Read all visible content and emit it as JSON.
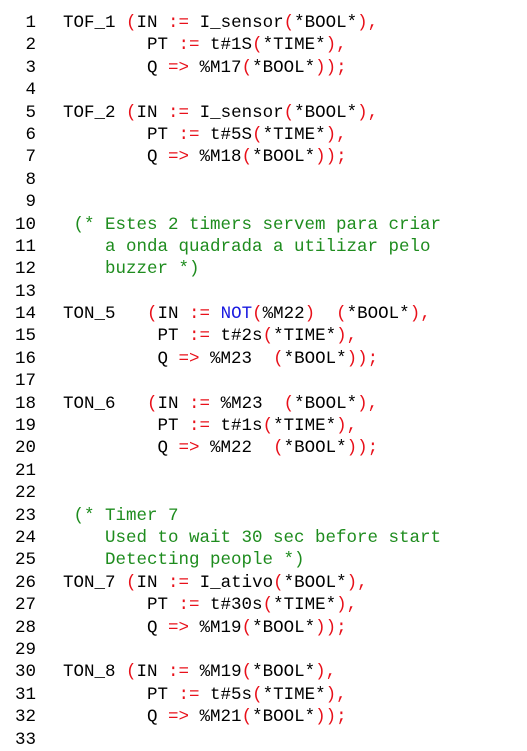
{
  "colors": {
    "background": "#ffffff",
    "default": "#000000",
    "operator": "#e8101a",
    "comment": "#1e8c1e",
    "keyword": "#1a1ae0"
  },
  "lines": [
    {
      "n": "1",
      "tokens": [
        {
          "t": "TOF_1 ",
          "c": "blk"
        },
        {
          "t": "(",
          "c": "red"
        },
        {
          "t": "IN ",
          "c": "blk"
        },
        {
          "t": ":=",
          "c": "red"
        },
        {
          "t": " I_sensor",
          "c": "blk"
        },
        {
          "t": "(",
          "c": "red"
        },
        {
          "t": "*BOOL*",
          "c": "blk"
        },
        {
          "t": "),",
          "c": "red"
        }
      ]
    },
    {
      "n": "2",
      "tokens": [
        {
          "t": "        PT ",
          "c": "blk"
        },
        {
          "t": ":=",
          "c": "red"
        },
        {
          "t": " t#1S",
          "c": "blk"
        },
        {
          "t": "(",
          "c": "red"
        },
        {
          "t": "*TIME*",
          "c": "blk"
        },
        {
          "t": "),",
          "c": "red"
        }
      ]
    },
    {
      "n": "3",
      "tokens": [
        {
          "t": "        Q ",
          "c": "blk"
        },
        {
          "t": "=>",
          "c": "red"
        },
        {
          "t": " %M17",
          "c": "blk"
        },
        {
          "t": "(",
          "c": "red"
        },
        {
          "t": "*BOOL*",
          "c": "blk"
        },
        {
          "t": "));",
          "c": "red"
        }
      ]
    },
    {
      "n": "4",
      "tokens": []
    },
    {
      "n": "5",
      "tokens": [
        {
          "t": "TOF_2 ",
          "c": "blk"
        },
        {
          "t": "(",
          "c": "red"
        },
        {
          "t": "IN ",
          "c": "blk"
        },
        {
          "t": ":=",
          "c": "red"
        },
        {
          "t": " I_sensor",
          "c": "blk"
        },
        {
          "t": "(",
          "c": "red"
        },
        {
          "t": "*BOOL*",
          "c": "blk"
        },
        {
          "t": "),",
          "c": "red"
        }
      ]
    },
    {
      "n": "6",
      "tokens": [
        {
          "t": "        PT ",
          "c": "blk"
        },
        {
          "t": ":=",
          "c": "red"
        },
        {
          "t": " t#5S",
          "c": "blk"
        },
        {
          "t": "(",
          "c": "red"
        },
        {
          "t": "*TIME*",
          "c": "blk"
        },
        {
          "t": "),",
          "c": "red"
        }
      ]
    },
    {
      "n": "7",
      "tokens": [
        {
          "t": "        Q ",
          "c": "blk"
        },
        {
          "t": "=>",
          "c": "red"
        },
        {
          "t": " %M18",
          "c": "blk"
        },
        {
          "t": "(",
          "c": "red"
        },
        {
          "t": "*BOOL*",
          "c": "blk"
        },
        {
          "t": "));",
          "c": "red"
        }
      ]
    },
    {
      "n": "8",
      "tokens": []
    },
    {
      "n": "9",
      "tokens": []
    },
    {
      "n": "10",
      "tokens": [
        {
          "t": " (* Estes 2 timers servem para criar",
          "c": "grn"
        }
      ]
    },
    {
      "n": "11",
      "tokens": [
        {
          "t": "    a onda quadrada a utilizar pelo",
          "c": "grn"
        }
      ]
    },
    {
      "n": "12",
      "tokens": [
        {
          "t": "    buzzer *)",
          "c": "grn"
        }
      ]
    },
    {
      "n": "13",
      "tokens": []
    },
    {
      "n": "14",
      "tokens": [
        {
          "t": "TON_5   ",
          "c": "blk"
        },
        {
          "t": "(",
          "c": "red"
        },
        {
          "t": "IN ",
          "c": "blk"
        },
        {
          "t": ":=",
          "c": "red"
        },
        {
          "t": " ",
          "c": "blk"
        },
        {
          "t": "NOT",
          "c": "blu"
        },
        {
          "t": "(",
          "c": "red"
        },
        {
          "t": "%M22",
          "c": "blk"
        },
        {
          "t": ")",
          "c": "red"
        },
        {
          "t": "  ",
          "c": "blk"
        },
        {
          "t": "(",
          "c": "red"
        },
        {
          "t": "*BOOL*",
          "c": "blk"
        },
        {
          "t": "),",
          "c": "red"
        }
      ]
    },
    {
      "n": "15",
      "tokens": [
        {
          "t": "         PT ",
          "c": "blk"
        },
        {
          "t": ":=",
          "c": "red"
        },
        {
          "t": " t#2s",
          "c": "blk"
        },
        {
          "t": "(",
          "c": "red"
        },
        {
          "t": "*TIME*",
          "c": "blk"
        },
        {
          "t": "),",
          "c": "red"
        }
      ]
    },
    {
      "n": "16",
      "tokens": [
        {
          "t": "         Q ",
          "c": "blk"
        },
        {
          "t": "=>",
          "c": "red"
        },
        {
          "t": " %M23  ",
          "c": "blk"
        },
        {
          "t": "(",
          "c": "red"
        },
        {
          "t": "*BOOL*",
          "c": "blk"
        },
        {
          "t": "));",
          "c": "red"
        }
      ]
    },
    {
      "n": "17",
      "tokens": []
    },
    {
      "n": "18",
      "tokens": [
        {
          "t": "TON_6   ",
          "c": "blk"
        },
        {
          "t": "(",
          "c": "red"
        },
        {
          "t": "IN ",
          "c": "blk"
        },
        {
          "t": ":=",
          "c": "red"
        },
        {
          "t": " %M23  ",
          "c": "blk"
        },
        {
          "t": "(",
          "c": "red"
        },
        {
          "t": "*BOOL*",
          "c": "blk"
        },
        {
          "t": "),",
          "c": "red"
        }
      ]
    },
    {
      "n": "19",
      "tokens": [
        {
          "t": "         PT ",
          "c": "blk"
        },
        {
          "t": ":=",
          "c": "red"
        },
        {
          "t": " t#1s",
          "c": "blk"
        },
        {
          "t": "(",
          "c": "red"
        },
        {
          "t": "*TIME*",
          "c": "blk"
        },
        {
          "t": "),",
          "c": "red"
        }
      ]
    },
    {
      "n": "20",
      "tokens": [
        {
          "t": "         Q ",
          "c": "blk"
        },
        {
          "t": "=>",
          "c": "red"
        },
        {
          "t": " %M22  ",
          "c": "blk"
        },
        {
          "t": "(",
          "c": "red"
        },
        {
          "t": "*BOOL*",
          "c": "blk"
        },
        {
          "t": "));",
          "c": "red"
        }
      ]
    },
    {
      "n": "21",
      "tokens": []
    },
    {
      "n": "22",
      "tokens": []
    },
    {
      "n": "23",
      "tokens": [
        {
          "t": " (* Timer 7",
          "c": "grn"
        }
      ]
    },
    {
      "n": "24",
      "tokens": [
        {
          "t": "    Used to wait 30 sec before start",
          "c": "grn"
        }
      ]
    },
    {
      "n": "25",
      "tokens": [
        {
          "t": "    Detecting people *)",
          "c": "grn"
        }
      ]
    },
    {
      "n": "26",
      "tokens": [
        {
          "t": "TON_7 ",
          "c": "blk"
        },
        {
          "t": "(",
          "c": "red"
        },
        {
          "t": "IN ",
          "c": "blk"
        },
        {
          "t": ":=",
          "c": "red"
        },
        {
          "t": " I_ativo",
          "c": "blk"
        },
        {
          "t": "(",
          "c": "red"
        },
        {
          "t": "*BOOL*",
          "c": "blk"
        },
        {
          "t": "),",
          "c": "red"
        }
      ]
    },
    {
      "n": "27",
      "tokens": [
        {
          "t": "        PT ",
          "c": "blk"
        },
        {
          "t": ":=",
          "c": "red"
        },
        {
          "t": " t#30s",
          "c": "blk"
        },
        {
          "t": "(",
          "c": "red"
        },
        {
          "t": "*TIME*",
          "c": "blk"
        },
        {
          "t": "),",
          "c": "red"
        }
      ]
    },
    {
      "n": "28",
      "tokens": [
        {
          "t": "        Q ",
          "c": "blk"
        },
        {
          "t": "=>",
          "c": "red"
        },
        {
          "t": " %M19",
          "c": "blk"
        },
        {
          "t": "(",
          "c": "red"
        },
        {
          "t": "*BOOL*",
          "c": "blk"
        },
        {
          "t": "));",
          "c": "red"
        }
      ]
    },
    {
      "n": "29",
      "tokens": []
    },
    {
      "n": "30",
      "tokens": [
        {
          "t": "TON_8 ",
          "c": "blk"
        },
        {
          "t": "(",
          "c": "red"
        },
        {
          "t": "IN ",
          "c": "blk"
        },
        {
          "t": ":=",
          "c": "red"
        },
        {
          "t": " %M19",
          "c": "blk"
        },
        {
          "t": "(",
          "c": "red"
        },
        {
          "t": "*BOOL*",
          "c": "blk"
        },
        {
          "t": "),",
          "c": "red"
        }
      ]
    },
    {
      "n": "31",
      "tokens": [
        {
          "t": "        PT ",
          "c": "blk"
        },
        {
          "t": ":=",
          "c": "red"
        },
        {
          "t": " t#5s",
          "c": "blk"
        },
        {
          "t": "(",
          "c": "red"
        },
        {
          "t": "*TIME*",
          "c": "blk"
        },
        {
          "t": "),",
          "c": "red"
        }
      ]
    },
    {
      "n": "32",
      "tokens": [
        {
          "t": "        Q ",
          "c": "blk"
        },
        {
          "t": "=>",
          "c": "red"
        },
        {
          "t": " %M21",
          "c": "blk"
        },
        {
          "t": "(",
          "c": "red"
        },
        {
          "t": "*BOOL*",
          "c": "blk"
        },
        {
          "t": "));",
          "c": "red"
        }
      ]
    },
    {
      "n": "33",
      "tokens": []
    }
  ]
}
